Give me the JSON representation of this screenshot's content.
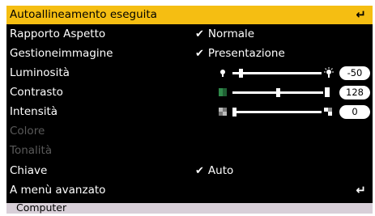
{
  "menu": {
    "items": [
      {
        "label": "Autoallineamento eseguita",
        "enter": "↵",
        "highlighted": true
      },
      {
        "label": "Rapporto Aspetto",
        "check": "✔",
        "value": "Normale"
      },
      {
        "label": "Gestioneimmagine",
        "check": "✔",
        "value": "Presentazione"
      },
      {
        "label": "Luminosità",
        "slider": {
          "value": "-50",
          "level": 0.08
        }
      },
      {
        "label": "Contrasto",
        "slider": {
          "value": "128",
          "level": 0.5
        }
      },
      {
        "label": "Intensità",
        "slider": {
          "value": "0",
          "level": 0.0
        }
      },
      {
        "label": "Colore",
        "disabled": true
      },
      {
        "label": "Tonalità",
        "disabled": true
      },
      {
        "label": "Chiave",
        "check": "✔",
        "value": "Auto"
      },
      {
        "label": "A menù avanzato",
        "enter": "↵"
      }
    ]
  },
  "footer": {
    "source": "Computer"
  },
  "colors": {
    "highlight": "#f5be12",
    "background": "#000000",
    "footer": "#d8cfd8",
    "disabled_text": "#5a5a5a"
  },
  "icons": {
    "luminosita_low": "bulb-dim-icon",
    "luminosita_high": "bulb-bright-icon",
    "contrasto_low": "contrast-low-icon",
    "contrasto_high": "contrast-high-icon",
    "intensita_low": "intensity-low-icon",
    "intensita_high": "intensity-high-icon"
  }
}
